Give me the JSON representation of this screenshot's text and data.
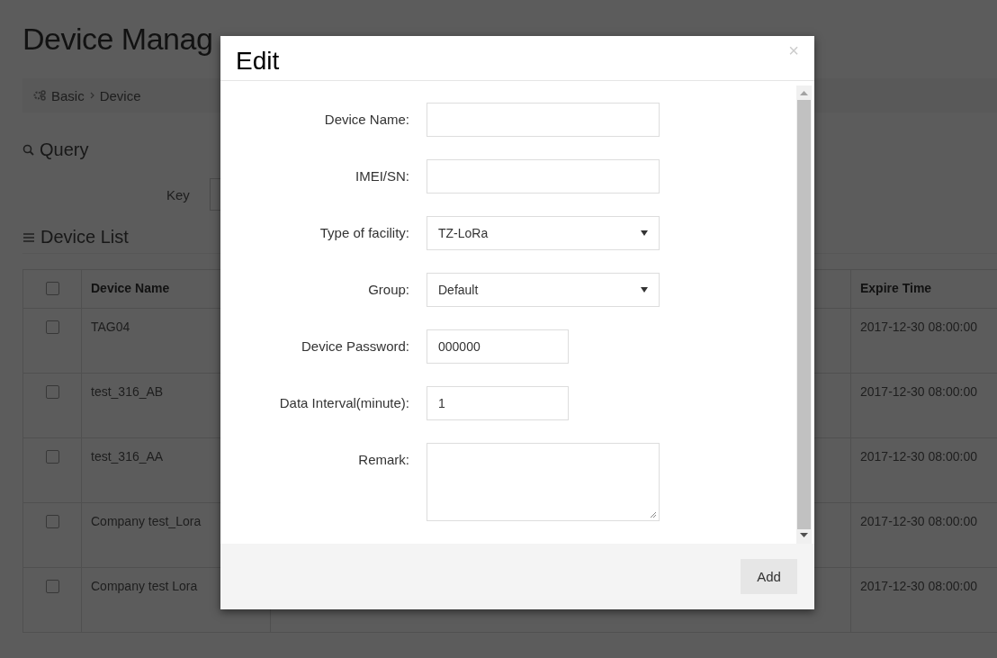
{
  "page": {
    "title": "Device Manag",
    "breadcrumb": [
      "Basic",
      "Device"
    ],
    "query_heading": "Query",
    "key_label": "Key",
    "list_heading": "Device List"
  },
  "table": {
    "select_all": {
      "checked": false
    },
    "columns": [
      "Device Name",
      "Expire Time"
    ],
    "rows": [
      {
        "checked": false,
        "name": "TAG04",
        "expire": "2017-12-30 08:00:00"
      },
      {
        "checked": false,
        "name": "test_316_AB",
        "expire": "2017-12-30 08:00:00"
      },
      {
        "checked": false,
        "name": "test_316_AA",
        "expire": "2017-12-30 08:00:00"
      },
      {
        "checked": false,
        "name": "Company test_Lora",
        "expire": "2017-12-30 08:00:00"
      },
      {
        "checked": false,
        "name": "Company test Lora",
        "expire": "2017-12-30 08:00:00"
      }
    ]
  },
  "dialog": {
    "title": "Edit",
    "close": "×",
    "fields": [
      {
        "kind": "text",
        "label": "Device Name:"
      },
      {
        "kind": "text",
        "label": "IMEI/SN:"
      },
      {
        "kind": "select",
        "label": "Type of facility:",
        "value": "TZ-LoRa"
      },
      {
        "kind": "select",
        "label": "Group:",
        "value": "Default"
      },
      {
        "kind": "short",
        "label": "Device Password:",
        "value": "000000"
      },
      {
        "kind": "short",
        "label": "Data Interval(minute):",
        "value": "1"
      },
      {
        "kind": "textarea",
        "label": "Remark:"
      }
    ],
    "buttons": [
      "Add"
    ]
  }
}
